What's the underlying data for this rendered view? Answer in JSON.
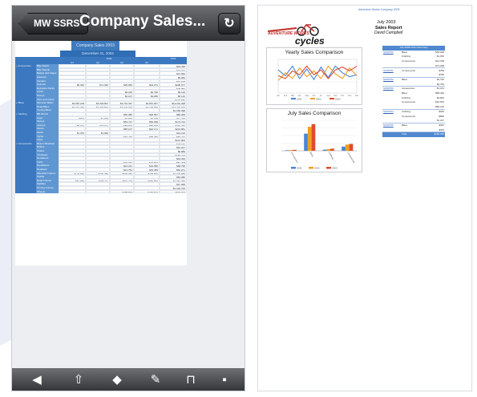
{
  "phone": {
    "back_label": "MW SSRS",
    "title": "Company Sales...",
    "refresh_glyph": "↻",
    "report_title": "Company Sales 2003",
    "report_date": "December 31, 2003",
    "year_headers": [
      "2003",
      "2003"
    ],
    "quarter_headers": [
      "Q1",
      "Q2",
      "Q3",
      "Q4"
    ],
    "groups": [
      {
        "category": "Accessories",
        "rows": [
          {
            "sub": "Bike Racks",
            "vals": [
              "",
              "",
              "",
              "",
              "$19,490"
            ]
          },
          {
            "sub": "Bike Stands",
            "vals": [
              "",
              "",
              "",
              "",
              "$16,921"
            ]
          },
          {
            "sub": "Bottles and Cages",
            "vals": [
              "",
              "",
              "",
              "",
              "$37,960"
            ]
          },
          {
            "sub": "Cleaners",
            "vals": [
              "",
              "",
              "",
              "",
              "$6,984"
            ]
          },
          {
            "sub": "Fenders",
            "vals": [
              "",
              "",
              "",
              "",
              "$16,928"
            ]
          },
          {
            "sub": "Helmets",
            "vals": [
              "$5,040",
              "$71,030",
              "$35,650",
              "$43,271",
              "$200,577"
            ]
          },
          {
            "sub": "Hydration Packs",
            "vals": [
              "",
              "",
              "",
              "",
              "$35,887"
            ]
          },
          {
            "sub": "Locks",
            "vals": [
              "",
              "",
              "$6,225",
              "$2,790",
              "$9,125"
            ]
          },
          {
            "sub": "Pumps",
            "vals": [
              "",
              "",
              "$2,107",
              "$3,286",
              "$5,140"
            ]
          },
          {
            "sub": "Tires and Tubes",
            "vals": [
              "",
              "",
              "",
              "",
              "$102,586"
            ]
          }
        ]
      },
      {
        "category": "Bikes",
        "rows": [
          {
            "sub": "Mountain Bikes",
            "vals": [
              "$2,987,218",
              "$4,039,807",
              "$3,751,497",
              "$3,857,837",
              "$14,691,398"
            ]
          },
          {
            "sub": "Road Bikes",
            "vals": [
              "$3,771,799",
              "$4,076,862",
              "$4,023,930",
              "$4,179,653",
              "$16,292,020"
            ]
          },
          {
            "sub": "Touring Bikes",
            "vals": [
              "",
              "",
              "",
              "",
              "$1,656,098"
            ]
          }
        ]
      },
      {
        "category": "Clothing",
        "rows": [
          {
            "sub": "Bib-Shorts",
            "vals": [
              "",
              "",
              "$56,080",
              "$25,557",
              "$86,258"
            ]
          },
          {
            "sub": "Caps",
            "vals": [
              "$823",
              "$1,676",
              "$2,867",
              "$3,035",
              "$11,277"
            ]
          },
          {
            "sub": "Gloves",
            "vals": [
              "",
              "",
              "$53,727",
              "$56,099",
              "$174,722"
            ]
          },
          {
            "sub": "Jerseys",
            "vals": [
              "$8,071",
              "$18,021",
              "$88,600",
              "$55,538",
              "$362,266"
            ]
          },
          {
            "sub": "Shorts",
            "vals": [
              "",
              "",
              "$85,107",
              "$22,171",
              "$216,881"
            ]
          },
          {
            "sub": "Socks",
            "vals": [
              "$1,076",
              "$1,969",
              "",
              "",
              "$13,193"
            ]
          },
          {
            "sub": "Tights",
            "vals": [
              "",
              "",
              "$87,239",
              "$88,780",
              "$86,272"
            ]
          },
          {
            "sub": "Vests",
            "vals": [
              "",
              "",
              "",
              "",
              "$147,802"
            ]
          }
        ]
      },
      {
        "category": "Components",
        "rows": [
          {
            "sub": "Bottom Brackets",
            "vals": [
              "",
              "",
              "",
              "",
              "$28,150"
            ]
          },
          {
            "sub": "Brakes",
            "vals": [
              "",
              "",
              "",
              "",
              "$46,237"
            ]
          },
          {
            "sub": "Chains",
            "vals": [
              "",
              "",
              "",
              "",
              "$9,889"
            ]
          },
          {
            "sub": "Cranksets",
            "vals": [
              "",
              "",
              "",
              "",
              "$155,477"
            ]
          },
          {
            "sub": "Derailleurs",
            "vals": [
              "",
              "",
              "",
              "",
              "$64,393"
            ]
          },
          {
            "sub": "Forks",
            "vals": [
              "",
              "",
              "$20,767",
              "$23,590",
              "$82,208"
            ]
          },
          {
            "sub": "Handlebars",
            "vals": [
              "",
              "",
              "$24,241",
              "$16,580",
              "$68,796"
            ]
          },
          {
            "sub": "Headsets",
            "vals": [
              "",
              "",
              "$12,752",
              "$15,355",
              "$52,071"
            ]
          },
          {
            "sub": "Mountain Frames",
            "vals": [
              "$127,659",
              "$226,383",
              "$806,082",
              "$405,590",
              "$2,906,888"
            ]
          },
          {
            "sub": "Pedals",
            "vals": [
              "",
              "",
              "",
              "",
              "$84,080"
            ]
          },
          {
            "sub": "Road Frames",
            "vals": [
              "$81,689",
              "$155,211",
              "$591,118",
              "$350,560",
              "$1,952,756"
            ]
          },
          {
            "sub": "Saddles",
            "vals": [
              "",
              "",
              "",
              "",
              "$37,068"
            ]
          },
          {
            "sub": "Touring Frames",
            "vals": [
              "",
              "",
              "",
              "",
              "$1,004,793"
            ]
          },
          {
            "sub": "Wheels",
            "vals": [
              "",
              "",
              "$288,836",
              "$183,563",
              "$593,677"
            ]
          }
        ]
      }
    ],
    "toolbar_icons": [
      {
        "name": "back-arrow-icon",
        "glyph": "◀"
      },
      {
        "name": "share-icon",
        "glyph": "⇧"
      },
      {
        "name": "directions-icon",
        "glyph": "◆"
      },
      {
        "name": "edit-icon",
        "glyph": "✎"
      },
      {
        "name": "bookmarks-icon",
        "glyph": "⊓"
      },
      {
        "name": "tabs-icon",
        "glyph": "▪"
      }
    ]
  },
  "page": {
    "top_link": "Adventure Works Company 2003",
    "logo_text1": "ADVENTURE WORKS",
    "logo_text2": "cycles",
    "month": "July 2003",
    "title": "Sales Report",
    "author": "David Campbell",
    "yearly_chart_title": "Yearly Sales Comparison",
    "july_chart_title": "July Sales Comparison",
    "table_header": "July 2003 Order Summary",
    "orders": [
      {
        "order": "SO50750",
        "rows": [
          [
            "Bikes",
            "$59,048"
          ],
          [
            "Clothing",
            "$1,052"
          ],
          [
            "Components",
            "$14,198"
          ],
          [
            "",
            "$74,298"
          ]
        ]
      },
      {
        "order": "SO50751",
        "rows": [
          [
            "Components",
            "$786"
          ],
          [
            "",
            "$786"
          ]
        ]
      },
      {
        "order": "SO50752",
        "rows": [
          [
            "Bikes",
            "$2,792"
          ],
          [
            "",
            "$2,792"
          ]
        ]
      },
      {
        "order": "SO50753",
        "rows": [
          [
            "Accessories",
            "$1,181"
          ],
          [
            "Bikes",
            "$58,449"
          ],
          [
            "Clothing",
            "$3,892"
          ],
          [
            "Components",
            "$22,694"
          ],
          [
            "",
            "$86,216"
          ]
        ]
      },
      {
        "order": "SO50754",
        "rows": [
          [
            "Clothing",
            "$336"
          ],
          [
            "Components",
            "$890"
          ],
          [
            "",
            "$1,227"
          ]
        ]
      },
      {
        "order": "SO50755",
        "rows": [
          [
            "Bikes",
            "$354"
          ],
          [
            "",
            "$354"
          ]
        ]
      }
    ],
    "total_label": "Total",
    "total_value": "$165,266",
    "colors": {
      "series1": "#4a86d8",
      "series2": "#f0a020",
      "series3": "#e04a30"
    }
  },
  "chart_data": [
    {
      "type": "line",
      "title": "Yearly Sales Comparison",
      "x": [
        "Jan",
        "Feb",
        "Mar",
        "Apr",
        "May",
        "Jun",
        "Jul",
        "Aug",
        "Sep",
        "Oct",
        "Nov",
        "Dec"
      ],
      "ylim": [
        0,
        700000
      ],
      "series": [
        {
          "name": "2001",
          "values": [
            480000,
            360000,
            560000,
            300000,
            500000,
            280000,
            540000,
            320000,
            560000,
            420000,
            340000,
            380000
          ]
        },
        {
          "name": "2002",
          "values": [
            260000,
            420000,
            300000,
            520000,
            340000,
            460000,
            300000,
            560000,
            400000,
            300000,
            520000,
            360000
          ]
        },
        {
          "name": "2003",
          "values": [
            360000,
            300000,
            460000,
            380000,
            560000,
            380000,
            480000,
            300000,
            480000,
            540000,
            460000,
            560000
          ]
        }
      ]
    },
    {
      "type": "bar",
      "title": "July Sales Comparison",
      "categories": [
        "Accessories",
        "Bikes",
        "Clothing",
        "Components"
      ],
      "ylim": [
        0,
        16000000
      ],
      "series": [
        {
          "name": "2001",
          "values": [
            300000,
            9000000,
            600000,
            2200000
          ]
        },
        {
          "name": "2002",
          "values": [
            400000,
            12600000,
            900000,
            3300000
          ]
        },
        {
          "name": "2003",
          "values": [
            500000,
            14000000,
            1100000,
            3600000
          ]
        }
      ]
    }
  ]
}
